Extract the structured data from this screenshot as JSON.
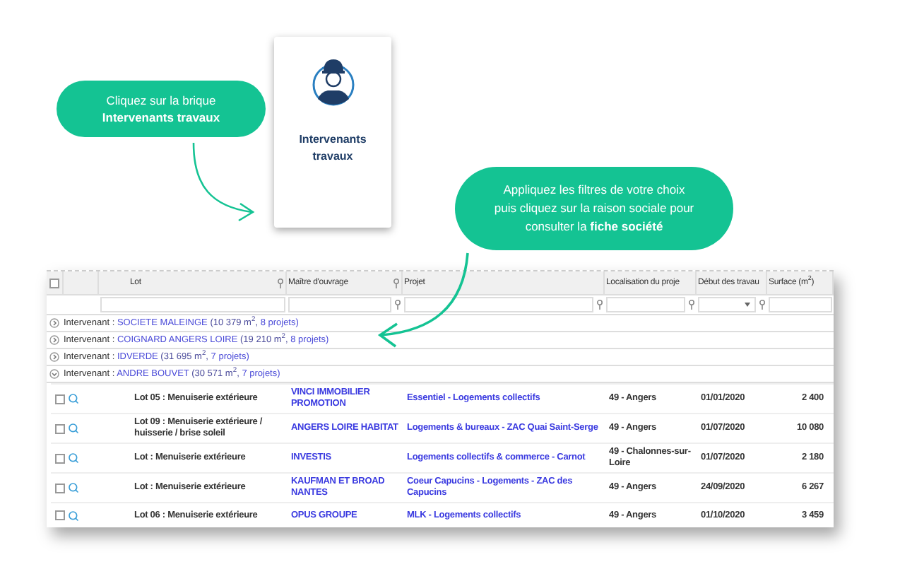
{
  "callouts": [
    {
      "lines": [
        "Cliquez sur la brique",
        "**Intervenants travaux**"
      ]
    },
    {
      "lines": [
        "Appliquez les filtres de votre choix",
        "puis cliquez sur la raison sociale pour",
        "consulter la **fiche société**"
      ]
    }
  ],
  "tile": {
    "title": "Intervenants travaux"
  },
  "table": {
    "select_all": {
      "checked": false
    },
    "columns": [
      {
        "label": "Lot",
        "header_filter": true,
        "row_filter": false,
        "dropdown": false
      },
      {
        "label": "Maître d'ouvrage",
        "header_filter": true,
        "row_filter": true,
        "dropdown": false
      },
      {
        "label": "Projet",
        "header_filter": false,
        "row_filter": true,
        "dropdown": false
      },
      {
        "label": "Localisation du proje",
        "header_filter": false,
        "row_filter": true,
        "dropdown": false
      },
      {
        "label": "Début des travau",
        "header_filter": false,
        "row_filter": true,
        "dropdown": true
      },
      {
        "label": "Surface (m$^{2}$)",
        "header_filter": false,
        "row_filter": false,
        "dropdown": false
      }
    ],
    "groups": [
      {
        "prefix": "Intervenant :",
        "name": "SOCIETE MALEINGE",
        "surface": "(10 379 m$^{2}$,",
        "projects": "8 projets)",
        "expanded": false
      },
      {
        "prefix": "Intervenant :",
        "name": "COIGNARD ANGERS LOIRE",
        "surface": "(19 210 m$^{2}$,",
        "projects": "8 projets)",
        "expanded": false
      },
      {
        "prefix": "Intervenant :",
        "name": "IDVERDE",
        "surface": "(31 695 m$^{2}$,",
        "projects": "7 projets)",
        "expanded": false
      },
      {
        "prefix": "Intervenant :",
        "name": "ANDRE BOUVET",
        "surface": "(30 571 m$^{2}$,",
        "projects": "7 projets)",
        "expanded": true
      }
    ],
    "rows": [
      {
        "checked": false,
        "lot": "Lot 05 : Menuiserie extérieure",
        "owner": "VINCI IMMOBILIER PROMOTION",
        "project": "Essentiel - Logements collectifs",
        "location": "49 - Angers",
        "start": "01/01/2020",
        "surface": "2 400"
      },
      {
        "checked": false,
        "lot": "Lot 09 : Menuiserie extérieure / huisserie / brise soleil",
        "owner": "ANGERS LOIRE HABITAT",
        "project": "Logements & bureaux - ZAC Quai Saint-Serge",
        "location": "49 - Angers",
        "start": "01/07/2020",
        "surface": "10 080"
      },
      {
        "checked": false,
        "lot": "Lot : Menuiserie extérieure",
        "owner": "INVESTIS",
        "project": "Logements collectifs & commerce - Carnot",
        "location": "49 - Chalonnes-sur-Loire",
        "start": "01/07/2020",
        "surface": "2 180"
      },
      {
        "checked": false,
        "lot": "Lot : Menuiserie extérieure",
        "owner": "KAUFMAN ET BROAD NANTES",
        "project": "Coeur Capucins - Logements - ZAC des Capucins",
        "location": "49 - Angers",
        "start": "24/09/2020",
        "surface": "6 267"
      },
      {
        "checked": false,
        "lot": "Lot 06 : Menuiserie extérieure",
        "owner": "OPUS GROUPE",
        "project": "MLK - Logements collectifs",
        "location": "49 - Angers",
        "start": "01/10/2020",
        "surface": "3 459"
      }
    ]
  }
}
